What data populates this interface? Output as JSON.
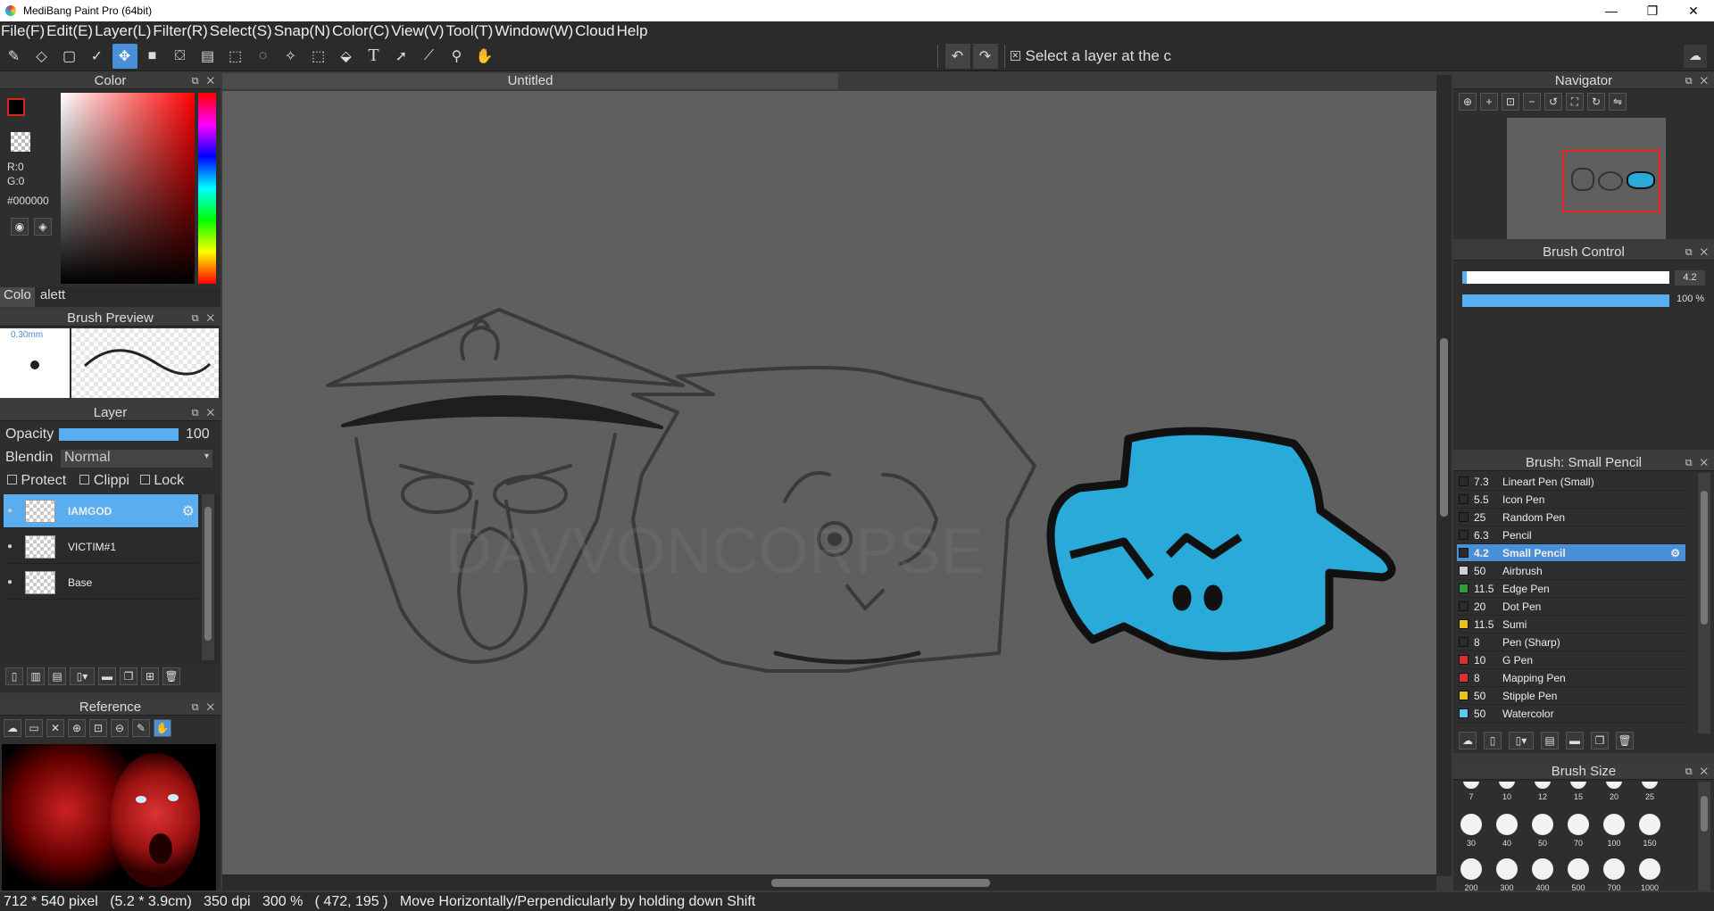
{
  "window": {
    "title": "MediBang Paint Pro (64bit)",
    "controls": [
      "—",
      "❐",
      "✕"
    ]
  },
  "menu": [
    "File(F)",
    "Edit(E)",
    "Layer(L)",
    "Filter(R)",
    "Select(S)",
    "Snap(N)",
    "Color(C)",
    "View(V)",
    "Tool(T)",
    "Window(W)",
    "Cloud",
    "Help"
  ],
  "toolbar": {
    "hint": "Select a layer at the c"
  },
  "color_panel": {
    "title": "Color",
    "r": "R:0",
    "g": "G:0",
    "hex": "#000000",
    "tabs": [
      "Colo",
      "alett"
    ],
    "fg": "#000000"
  },
  "brush_preview": {
    "title": "Brush Preview",
    "size": "0.30mm"
  },
  "layer_panel": {
    "title": "Layer",
    "opacity_label": "Opacity",
    "opacity_value": "100",
    "blending_label": "Blendin",
    "blending_value": "Normal",
    "protect": "Protect A",
    "clipping": "Clippi",
    "lock": "Lock",
    "layers": [
      "IAMGOD",
      "VICTIM#1",
      "Base"
    ]
  },
  "reference": {
    "title": "Reference"
  },
  "document": {
    "tab": "Untitled",
    "watermark": "DAVVONCORPSE"
  },
  "navigator": {
    "title": "Navigator"
  },
  "brush_control": {
    "title": "Brush Control",
    "size": "4.2",
    "opacity": "100 %",
    "size_fraction": 0.02,
    "opacity_fraction": 1.0
  },
  "brush_list": {
    "title": "Brush: Small Pencil",
    "items": [
      {
        "size": "7.3",
        "name": "Lineart Pen (Small)",
        "color": "#2a2a2a"
      },
      {
        "size": "5.5",
        "name": "Icon Pen",
        "color": "#2a2a2a"
      },
      {
        "size": "25",
        "name": "Random Pen",
        "color": "#2a2a2a"
      },
      {
        "size": "6.3",
        "name": "Pencil",
        "color": "#2a2a2a"
      },
      {
        "size": "4.2",
        "name": "Small Pencil",
        "color": "#2a2a2a"
      },
      {
        "size": "50",
        "name": "Airbrush",
        "color": "#cfcfcf"
      },
      {
        "size": "11.5",
        "name": "Edge Pen",
        "color": "#2e9e3a"
      },
      {
        "size": "20",
        "name": "Dot Pen",
        "color": "#2a2a2a"
      },
      {
        "size": "11.5",
        "name": "Sumi",
        "color": "#e8c21c"
      },
      {
        "size": "8",
        "name": "Pen (Sharp)",
        "color": "#2a2a2a"
      },
      {
        "size": "10",
        "name": "G Pen",
        "color": "#d93030"
      },
      {
        "size": "8",
        "name": "Mapping Pen",
        "color": "#d93030"
      },
      {
        "size": "50",
        "name": "Stipple Pen",
        "color": "#e8c21c"
      },
      {
        "size": "50",
        "name": "Watercolor",
        "color": "#5ac8f0"
      }
    ]
  },
  "brush_size": {
    "title": "Brush Size",
    "row1": [
      "7",
      "10",
      "12",
      "15",
      "20",
      "25"
    ],
    "row2": [
      "30",
      "40",
      "50",
      "70",
      "100",
      "150"
    ],
    "row3": [
      "200",
      "300",
      "400",
      "500",
      "700",
      "1000"
    ]
  },
  "status": {
    "text": "712 * 540 pixel   (5.2 * 3.9cm)   350 dpi   300 %   ( 472, 195 )   Move Horizontally/Perpendicularly by holding down Shift"
  }
}
